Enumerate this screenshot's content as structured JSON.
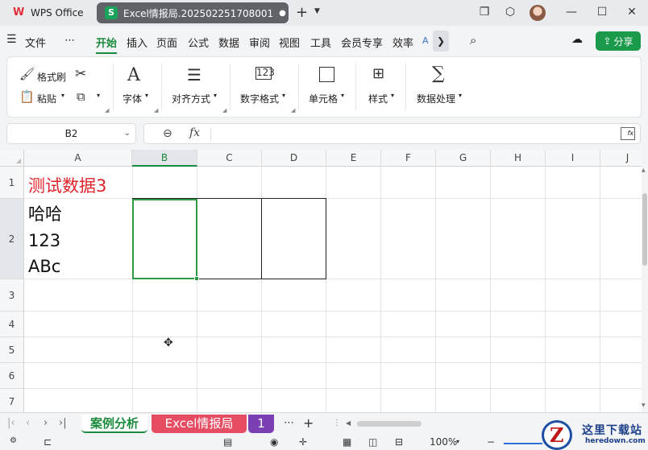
{
  "window": {
    "app_tab": "WPS Office",
    "doc_tab": "Excel情报局.202502251708001",
    "doc_tab_icon": "S",
    "doc_tab_modified": "●",
    "new_tab": "+"
  },
  "menu": {
    "file": "文件",
    "more": "⋯",
    "items": [
      "开始",
      "插入",
      "页面",
      "公式",
      "数据",
      "审阅",
      "视图",
      "工具",
      "会员专享",
      "效率"
    ],
    "active": "开始",
    "share": "分享"
  },
  "ribbon": {
    "format_painter": "格式刷",
    "paste": "粘贴",
    "font": "字体",
    "align": "对齐方式",
    "number_format": "数字格式",
    "cell": "单元格",
    "style": "样式",
    "data_process": "数据处理"
  },
  "formula_bar": {
    "name_box": "B2",
    "fx": "fx",
    "formula": ""
  },
  "grid": {
    "columns": [
      "A",
      "B",
      "C",
      "D",
      "E",
      "F",
      "G",
      "H",
      "I",
      "J"
    ],
    "rows": [
      "1",
      "2",
      "3",
      "4",
      "5",
      "6",
      "7"
    ],
    "selected_cell": "B2",
    "cells": {
      "A1": "测试数据3",
      "A2_line1": "哈哈",
      "A2_line2": "123",
      "A2_line3": "ABc"
    },
    "colors": {
      "A1_text": "#e0242d",
      "selection": "#2e9a45"
    }
  },
  "sheets": {
    "tabs": [
      "案例分析",
      "Excel情报局",
      "1"
    ],
    "active": "案例分析",
    "add": "+",
    "more": "⋯"
  },
  "status": {
    "zoom": "100%"
  },
  "watermark": {
    "title": "这里下载站",
    "url": "heredown.com"
  }
}
